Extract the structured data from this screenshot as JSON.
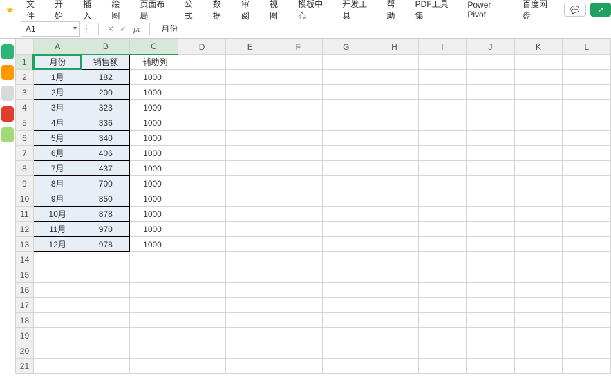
{
  "menu": {
    "items": [
      "文件",
      "开始",
      "插入",
      "绘图",
      "页面布局",
      "公式",
      "数据",
      "审阅",
      "视图",
      "模板中心",
      "开发工具",
      "帮助",
      "PDF工具集",
      "Power Pivot",
      "百度网盘"
    ]
  },
  "namebox": {
    "value": "A1"
  },
  "formula": {
    "value": "月份",
    "fx": "fx"
  },
  "columns": [
    "A",
    "B",
    "C",
    "D",
    "E",
    "F",
    "G",
    "H",
    "I",
    "J",
    "K",
    "L"
  ],
  "rows_count": 21,
  "selected_columns": [
    "A",
    "B",
    "C"
  ],
  "selected_row": 1,
  "selected_cell": "A1",
  "headers": {
    "A": "月份",
    "B": "销售额",
    "C": "辅助列"
  },
  "cells": [
    {
      "A": "1月",
      "B": "182",
      "C": "1000"
    },
    {
      "A": "2月",
      "B": "200",
      "C": "1000"
    },
    {
      "A": "3月",
      "B": "323",
      "C": "1000"
    },
    {
      "A": "4月",
      "B": "336",
      "C": "1000"
    },
    {
      "A": "5月",
      "B": "340",
      "C": "1000"
    },
    {
      "A": "6月",
      "B": "406",
      "C": "1000"
    },
    {
      "A": "7月",
      "B": "437",
      "C": "1000"
    },
    {
      "A": "8月",
      "B": "700",
      "C": "1000"
    },
    {
      "A": "9月",
      "B": "850",
      "C": "1000"
    },
    {
      "A": "10月",
      "B": "878",
      "C": "1000"
    },
    {
      "A": "11月",
      "B": "970",
      "C": "1000"
    },
    {
      "A": "12月",
      "B": "978",
      "C": "1000"
    }
  ]
}
